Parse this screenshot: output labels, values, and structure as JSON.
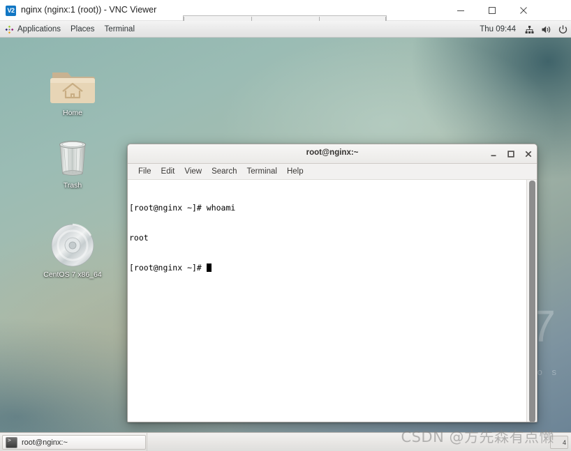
{
  "vnc_window": {
    "logo_text": "V2",
    "title": "nginx (nginx:1 (root)) - VNC Viewer",
    "controls": {
      "minimize": "Minimize",
      "maximize": "Maximize",
      "close": "Close"
    }
  },
  "gnome_panel": {
    "menus": [
      {
        "label": "Applications",
        "icon": "centos-badge-icon"
      },
      {
        "label": "Places",
        "icon": ""
      },
      {
        "label": "Terminal",
        "icon": ""
      }
    ],
    "clock": "Thu 09:44",
    "tray": [
      {
        "name": "network-icon"
      },
      {
        "name": "volume-icon"
      },
      {
        "name": "power-icon"
      }
    ]
  },
  "desktop": {
    "wallpaper_logo": {
      "number": "7",
      "word": "t o s"
    },
    "icons": [
      {
        "label": "Home",
        "icon": "home-folder-icon"
      },
      {
        "label": "Trash",
        "icon": "trash-can-icon"
      },
      {
        "label": "CentOS 7 x86_64",
        "icon": "optical-disc-icon"
      }
    ]
  },
  "terminal": {
    "title": "root@nginx:~",
    "controls": {
      "minimize": "Minimize",
      "maximize": "Maximize",
      "close": "Close"
    },
    "menus": [
      "File",
      "Edit",
      "View",
      "Search",
      "Terminal",
      "Help"
    ],
    "lines": [
      "[root@nginx ~]# whoami",
      "root",
      "[root@nginx ~]# "
    ],
    "colors": {
      "background": "#ffffff",
      "foreground": "#000000"
    }
  },
  "taskbar": {
    "window_button": {
      "label": "root@nginx:~",
      "icon": "terminal-icon"
    },
    "workspace": "4"
  },
  "watermark": {
    "text": "CSDN @方先森有点懒"
  }
}
